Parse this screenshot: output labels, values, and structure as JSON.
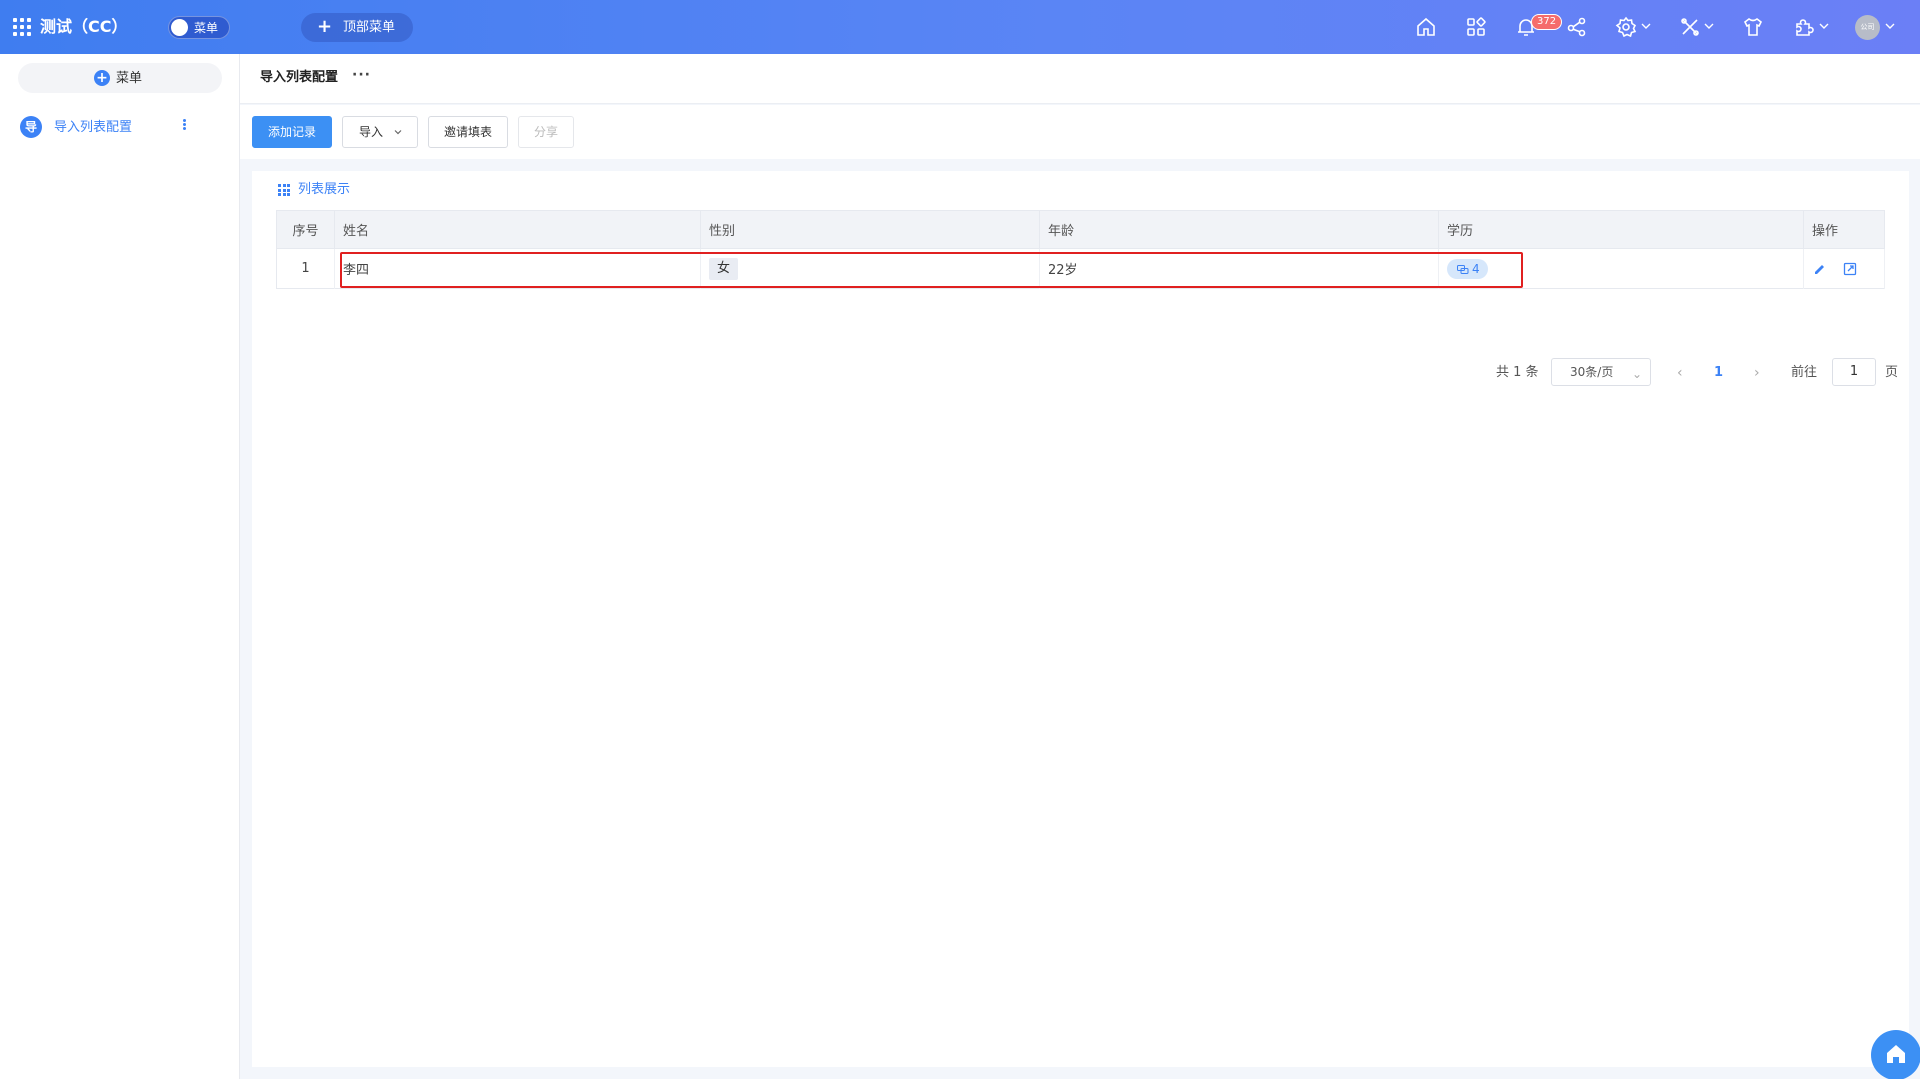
{
  "app": {
    "title": "测试（CC）",
    "menu_toggle_label": "菜单",
    "top_menu_label": "顶部菜单",
    "notification_count": "372",
    "avatar_text": "公司"
  },
  "header_icons": [
    "home-icon",
    "apps-grid-icon",
    "bell-icon",
    "share-icon",
    "settings-icon",
    "tools-icon",
    "shirt-icon",
    "puzzle-icon"
  ],
  "sidebar": {
    "add_label": "菜单",
    "items": [
      {
        "icon_text": "导",
        "label": "导入列表配置"
      }
    ]
  },
  "page": {
    "title": "导入列表配置",
    "more": "···"
  },
  "toolbar": {
    "add_record": "添加记录",
    "import": "导入",
    "invite_fill": "邀请填表",
    "share": "分享"
  },
  "card": {
    "title": "列表展示"
  },
  "table": {
    "columns": [
      "序号",
      "姓名",
      "性别",
      "年龄",
      "学历",
      "操作"
    ],
    "rows": [
      {
        "index": "1",
        "name": "李四",
        "gender": "女",
        "age": "22岁",
        "education_count": "4"
      }
    ]
  },
  "pagination": {
    "total": "共 1 条",
    "page_size": "30条/页",
    "current_page": "1",
    "goto_label": "前往",
    "goto_value": "1",
    "page_suffix": "页"
  },
  "colors": {
    "primary": "#3c90f4",
    "header_gradient_start": "#3f7df0",
    "header_gradient_end": "#6b7ff6",
    "highlight_border": "#e02020",
    "badge": "#f56c6c"
  }
}
